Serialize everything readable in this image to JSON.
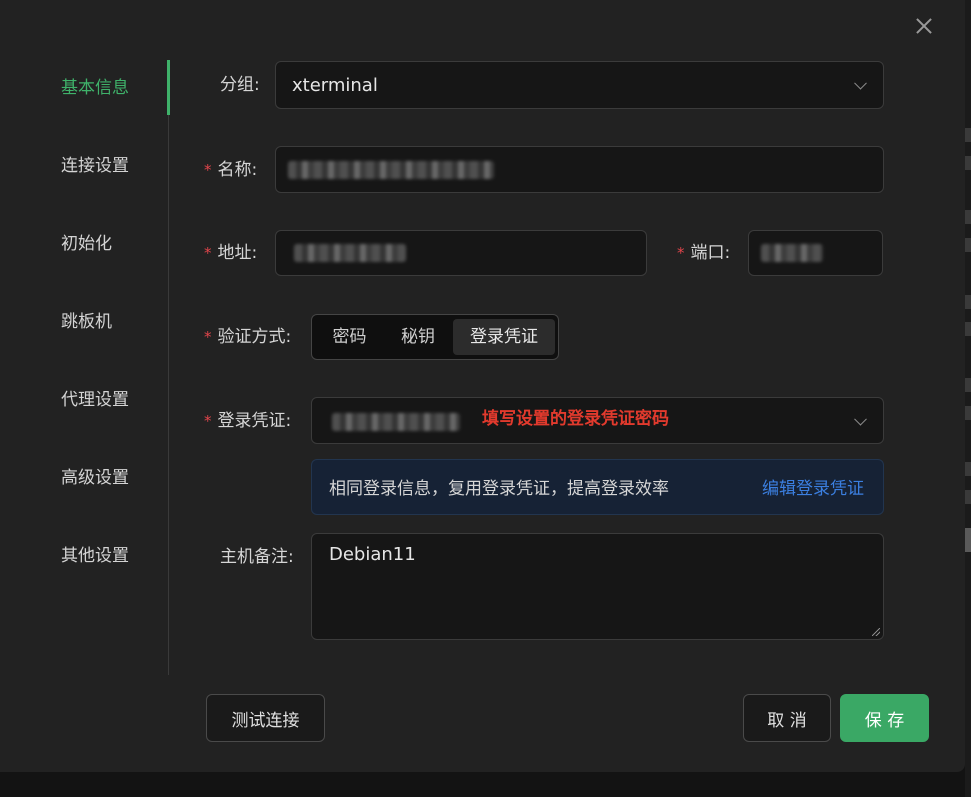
{
  "sidebar": {
    "items": [
      {
        "label": "基本信息",
        "active": true
      },
      {
        "label": "连接设置"
      },
      {
        "label": "初始化"
      },
      {
        "label": "跳板机"
      },
      {
        "label": "代理设置"
      },
      {
        "label": "高级设置"
      },
      {
        "label": "其他设置"
      }
    ]
  },
  "form": {
    "group": {
      "label": "分组:",
      "value": "xterminal"
    },
    "name": {
      "label": "名称:",
      "required": true
    },
    "address": {
      "label": "地址:",
      "required": true
    },
    "port": {
      "label": "端口:",
      "required": true
    },
    "auth": {
      "label": "验证方式:",
      "required": true,
      "options": [
        "密码",
        "秘钥",
        "登录凭证"
      ],
      "selected": "登录凭证"
    },
    "credential": {
      "label": "登录凭证:",
      "required": true
    },
    "info": {
      "text": "相同登录信息，复用登录凭证，提高登录效率",
      "link": "编辑登录凭证"
    },
    "note": {
      "label": "主机备注:",
      "value": "Debian11"
    }
  },
  "annotation": "填写设置的登录凭证密码",
  "buttons": {
    "test": "测试连接",
    "cancel": "取 消",
    "save": "保 存"
  },
  "colors": {
    "accent": "#3fb26a",
    "required": "#e0454b",
    "link": "#3b7fe0",
    "annotation": "#e23a2d",
    "save": "#3aa865"
  }
}
